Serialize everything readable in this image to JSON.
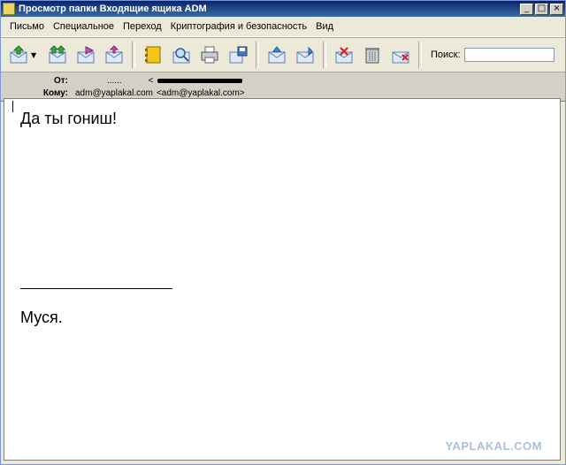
{
  "window": {
    "title": "Просмотр папки Входящие ящика ADM"
  },
  "titlebar_buttons": {
    "minimize": "_",
    "maximize": "□",
    "close": "×"
  },
  "menu": [
    "Письмо",
    "Специальное",
    "Переход",
    "Криптография и безопасность",
    "Вид"
  ],
  "toolbar": {
    "search_label": "Поиск:",
    "search_value": "",
    "icons": [
      "reply-icon",
      "reply-all-icon",
      "forward-icon",
      "forward-attach-icon",
      "address-book-icon",
      "find-icon",
      "print-icon",
      "save-icon",
      "move-prev-icon",
      "move-next-icon",
      "delete-icon",
      "trash-icon",
      "junk-icon"
    ]
  },
  "headers": {
    "from_label": "От:",
    "from_name": "......",
    "from_email": "<",
    "to_label": "Кому:",
    "to_name": "adm@yaplakal.com",
    "to_email": "<adm@yaplakal.com>"
  },
  "message": {
    "body": "Да ты гониш!",
    "signature": "Муся."
  },
  "watermark": "YAPLAKAL.COM"
}
